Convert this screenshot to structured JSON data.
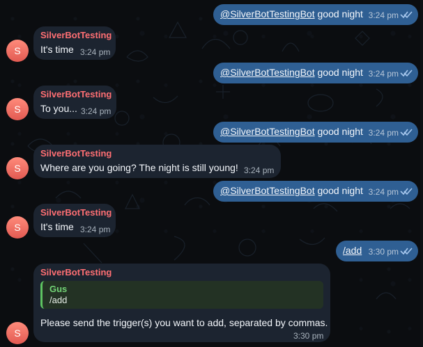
{
  "chat": {
    "messages": [
      {
        "direction": "out",
        "mention": "@SilverBotTestingBot",
        "text": "good night",
        "time": "3:24 pm"
      },
      {
        "direction": "in",
        "sender": "SilverBotTesting",
        "text": "It's time",
        "time": "3:24 pm",
        "avatar": "S"
      },
      {
        "direction": "out",
        "mention": "@SilverBotTestingBot",
        "text": "good night",
        "time": "3:24 pm"
      },
      {
        "direction": "in",
        "sender": "SilverBotTesting",
        "text": "To you...",
        "time": "3:24 pm",
        "avatar": "S"
      },
      {
        "direction": "out",
        "mention": "@SilverBotTestingBot",
        "text": "good night",
        "time": "3:24 pm"
      },
      {
        "direction": "in",
        "sender": "SilverBotTesting",
        "text": "Where are you going? The night is still young!",
        "time": "3:24 pm",
        "avatar": "S"
      },
      {
        "direction": "out",
        "mention": "@SilverBotTestingBot",
        "text": "good night",
        "time": "3:24 pm"
      },
      {
        "direction": "in",
        "sender": "SilverBotTesting",
        "text": "It's time",
        "time": "3:24 pm",
        "avatar": "S"
      },
      {
        "direction": "out",
        "command": "/add",
        "time": "3:30 pm"
      },
      {
        "direction": "in",
        "sender": "SilverBotTesting",
        "reply_to": {
          "name": "Gus",
          "text": "/add"
        },
        "text": "Please send the trigger(s) you want to add, separated by commas.",
        "time": "3:30 pm",
        "avatar": "S"
      }
    ]
  },
  "colors": {
    "outgoing_bubble": "#2f5f93",
    "incoming_bubble": "#1c2430",
    "sender_name": "#ff6f73",
    "reply_accent": "#5ec461",
    "avatar": "#ef6b61"
  },
  "icons": {
    "read_ticks": "double-check-icon"
  }
}
